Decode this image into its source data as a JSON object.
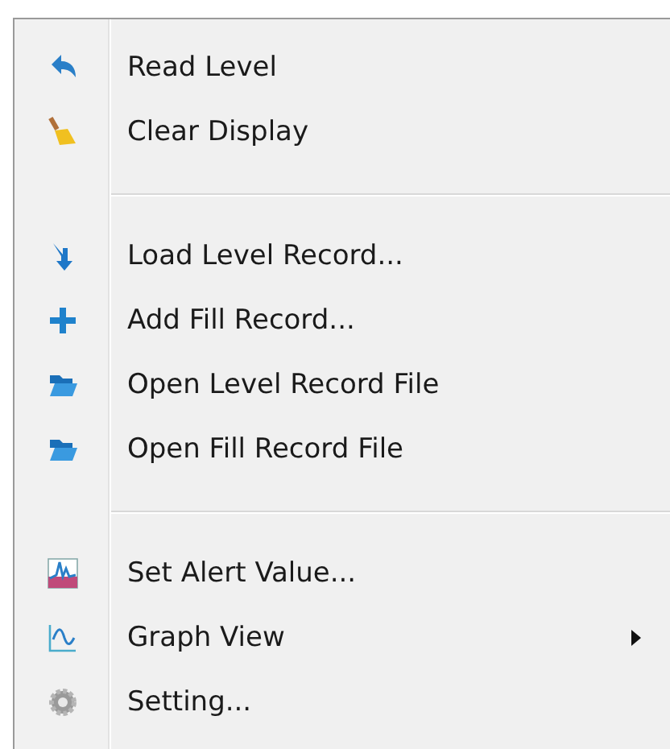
{
  "menu": {
    "items": [
      {
        "kind": "item",
        "label": "Read Level",
        "has_submenu": false
      },
      {
        "kind": "item",
        "label": "Clear Display",
        "has_submenu": false
      },
      {
        "kind": "separator"
      },
      {
        "kind": "item",
        "label": "Load Level Record...",
        "has_submenu": false
      },
      {
        "kind": "item",
        "label": "Add Fill Record...",
        "has_submenu": false
      },
      {
        "kind": "item",
        "label": "Open Level Record File",
        "has_submenu": false
      },
      {
        "kind": "item",
        "label": "Open Fill Record File",
        "has_submenu": false
      },
      {
        "kind": "separator"
      },
      {
        "kind": "item",
        "label": "Set Alert Value...",
        "has_submenu": false
      },
      {
        "kind": "item",
        "label": "Graph View",
        "has_submenu": true
      },
      {
        "kind": "item",
        "label": "Setting...",
        "has_submenu": false
      }
    ]
  }
}
